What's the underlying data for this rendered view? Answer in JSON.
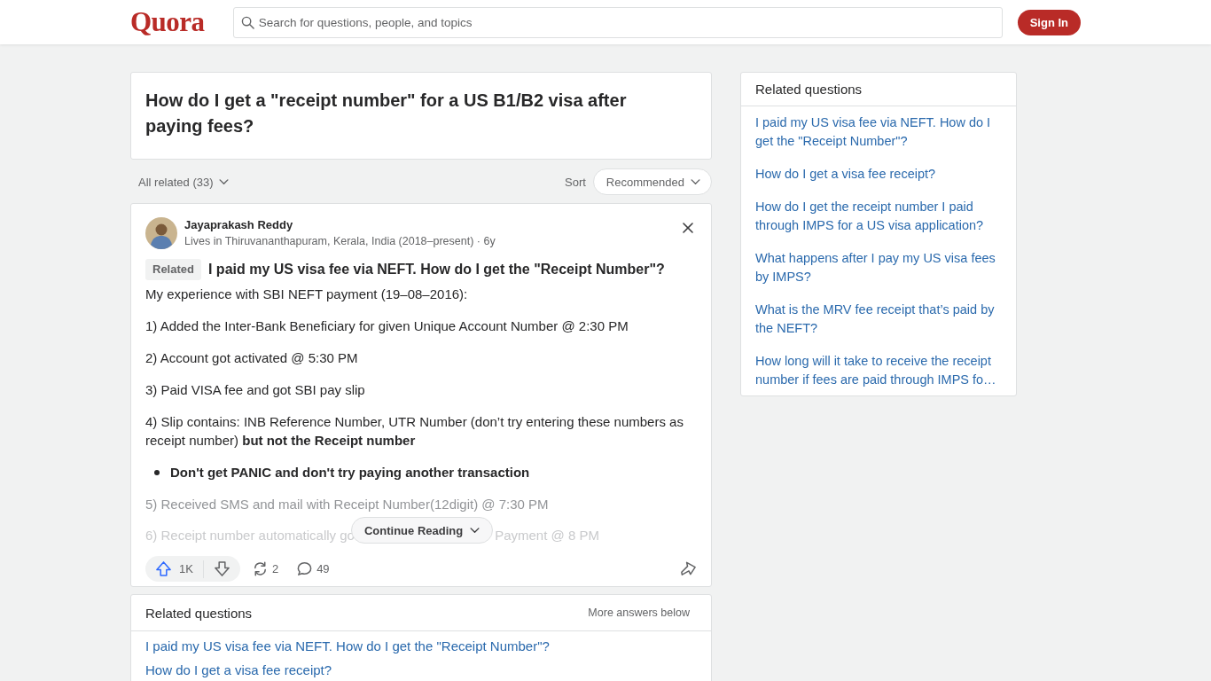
{
  "header": {
    "logo": "Quora",
    "search": {
      "placeholder": "Search for questions, people, and topics"
    },
    "sign_in_button": "Sign In"
  },
  "question": {
    "title": "How do I get a \"receipt number\" for a US B1/B2 visa after paying fees?"
  },
  "filter_bar": {
    "all_related": "All related (33)",
    "sort_label": "Sort",
    "sort_value": "Recommended"
  },
  "answer": {
    "author": {
      "name": "Jayaprakash Reddy",
      "meta": "Lives in Thiruvananthapuram, Kerala, India (2018–present) · 6y"
    },
    "related_tag": "Related",
    "related_question": "I paid my US visa fee via NEFT. How do I get the \"Receipt Number\"?",
    "body": [
      {
        "kind": "text",
        "faded": false,
        "text": "My experience with SBI NEFT payment (19–08–2016):"
      },
      {
        "kind": "text",
        "faded": false,
        "text": "1) Added the Inter-Bank Beneficiary for given Unique Account Number @ 2:30 PM"
      },
      {
        "kind": "text",
        "faded": false,
        "text": "2) Account got activated @ 5:30 PM"
      },
      {
        "kind": "text",
        "faded": false,
        "text": "3) Paid VISA fee and got SBI pay slip"
      },
      {
        "kind": "text",
        "faded": false,
        "text": "4) Slip contains: INB Reference Number, UTR Number (don’t try entering these numbers as receipt number) **but not the Receipt number**"
      },
      {
        "kind": "bullet",
        "faded": false,
        "text": "Don't get PANIC and don't try paying another transaction"
      },
      {
        "kind": "text",
        "faded": true,
        "text": "5) Received SMS and mail with Receipt Number(12digit) @ 7:30 PM"
      }
    ],
    "cut_line": {
      "before": "6) Receipt number automatically go",
      "after": "Payment @ 8 PM"
    },
    "continue_button": "Continue Reading",
    "actions": {
      "upvotes": "1K",
      "reshares": "2",
      "comments": "49"
    }
  },
  "related_main": {
    "title": "Related questions",
    "note": "More answers below",
    "items": [
      "I paid my US visa fee via NEFT. How do I get the \"Receipt Number\"?",
      "How do I get a visa fee receipt?"
    ]
  },
  "sidebar": {
    "title": "Related questions",
    "items": [
      "I paid my US visa fee via NEFT. How do I get the \"Receipt Number\"?",
      "How do I get a visa fee receipt?",
      "How do I get the receipt number I paid through IMPS for a US visa application?",
      "What happens after I pay my US visa fees by IMPS?",
      "What is the MRV fee receipt that’s paid by the NEFT?",
      "How long will it take to receive the receipt number if fees are paid through IMPS fo…"
    ]
  }
}
